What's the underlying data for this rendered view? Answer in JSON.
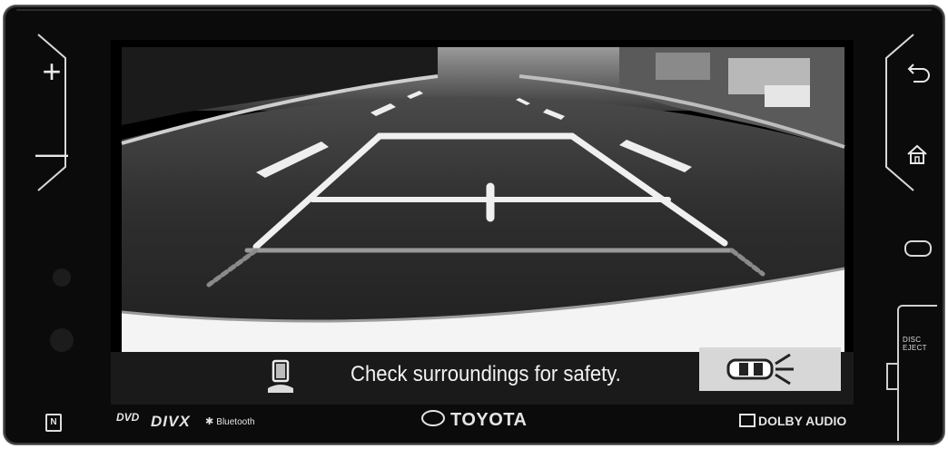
{
  "head_unit": {
    "brand": "TOYOTA",
    "logos": {
      "nfc": "N",
      "dvd": "DVD",
      "divx": "DIVX",
      "bluetooth": "Bluetooth",
      "dolby": "DOLBY AUDIO"
    },
    "side_keys": {
      "volume_up": "+",
      "volume_down": "—",
      "back": "back-arrow-icon",
      "home": "home-icon",
      "power": "power-icon"
    },
    "slot_label": "DISC EJECT"
  },
  "screen": {
    "camera_view": "rear-camera-feed",
    "status_message": "Check surroundings for safety.",
    "camera_view_button": "view-toggle-icon"
  },
  "colors": {
    "bezel": "#0b0b0b",
    "status_bar": "#1a1a1a",
    "view_button": "#d7d7d7",
    "guide_lines": "#f0f0f0"
  }
}
